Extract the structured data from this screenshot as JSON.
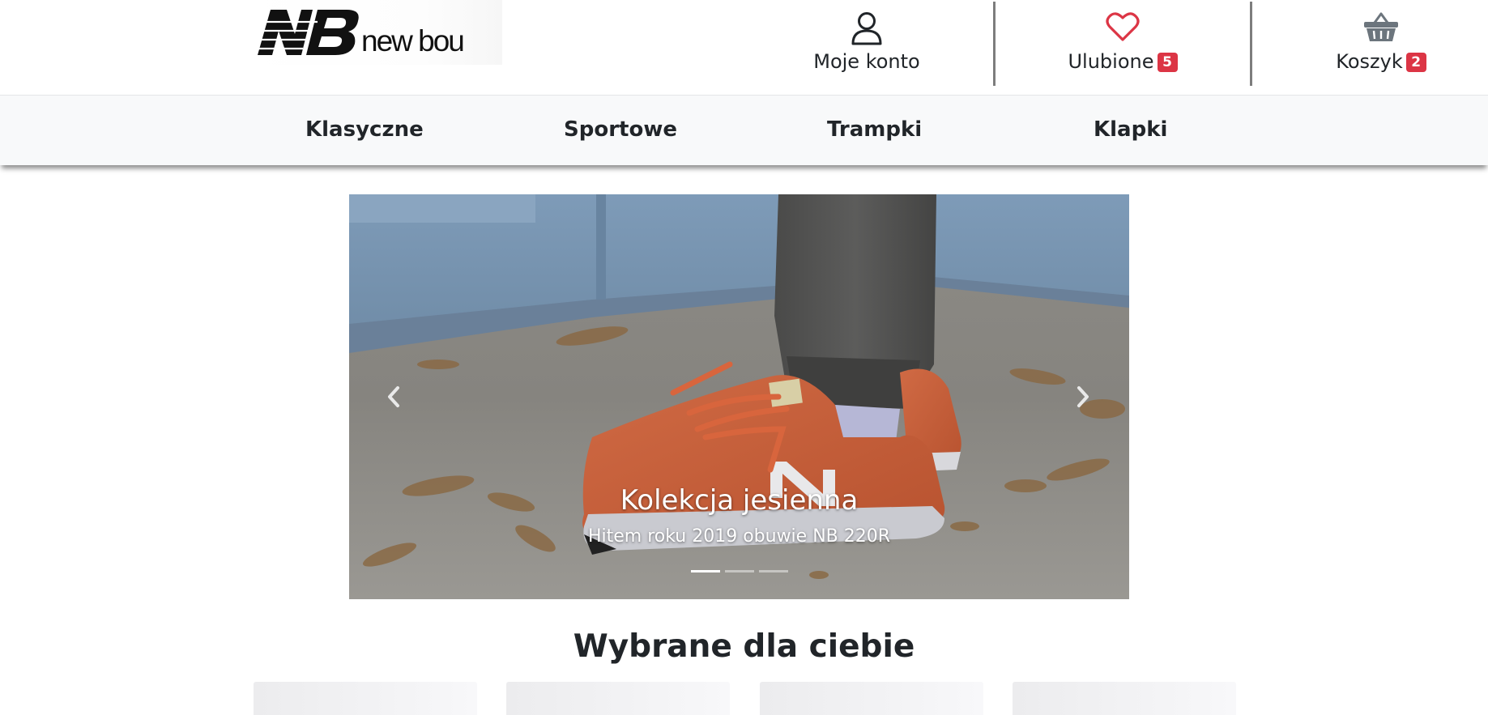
{
  "brand": {
    "logo_text": "new bou",
    "logo_mark": "NB"
  },
  "header": {
    "account": {
      "label": "Moje konto",
      "icon": "user-icon"
    },
    "favorites": {
      "label": "Ulubione",
      "count": "5",
      "icon": "heart-icon",
      "icon_color": "#dc3545"
    },
    "cart": {
      "label": "Koszyk",
      "count": "2",
      "icon": "basket-icon",
      "icon_color": "#6c757d"
    }
  },
  "nav": {
    "items": [
      {
        "label": "Klasyczne"
      },
      {
        "label": "Sportowe"
      },
      {
        "label": "Trampki"
      },
      {
        "label": "Klapki"
      }
    ]
  },
  "carousel": {
    "title": "Kolekcja jesienna",
    "text": "Hitem roku 2019 obuwie NB 220R",
    "slide_count": 3,
    "active_index": 0,
    "prev_icon": "chevron-left-icon",
    "next_icon": "chevron-right-icon"
  },
  "section": {
    "title": "Wybrane dla ciebie"
  },
  "colors": {
    "badge": "#dc3545",
    "nav_bg": "#f8f9fa",
    "text": "#212529"
  }
}
